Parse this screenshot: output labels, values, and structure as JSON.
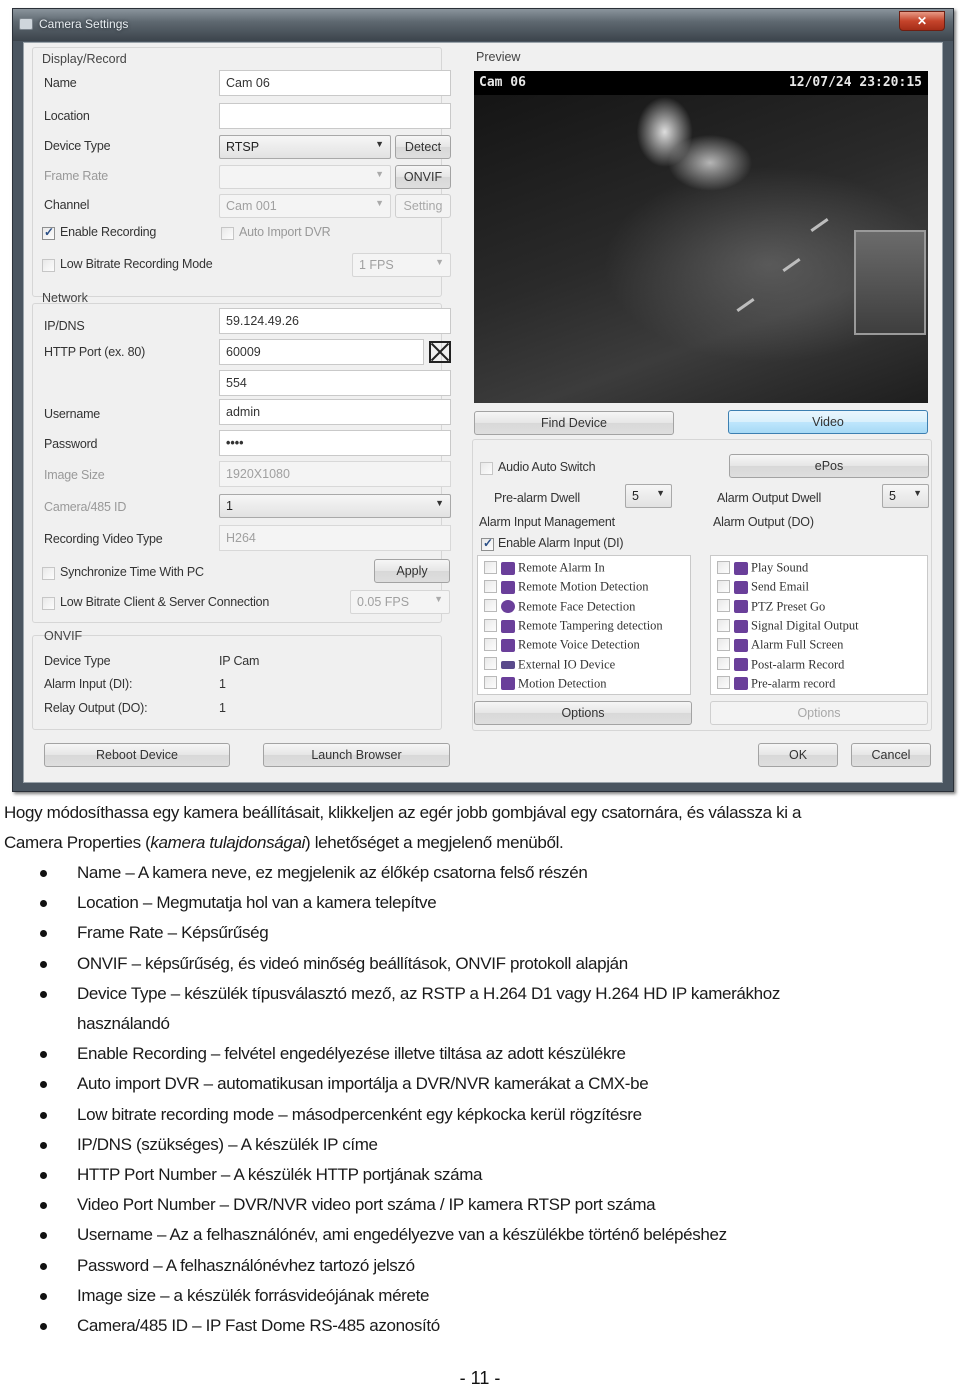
{
  "window": {
    "title": "Camera Settings",
    "close_glyph": "✕"
  },
  "display_record": {
    "section": "Display/Record",
    "name_label": "Name",
    "name_value": "Cam 06",
    "location_label": "Location",
    "location_value": "",
    "device_type_label": "Device Type",
    "device_type_value": "RTSP",
    "detect_button": "Detect",
    "frame_rate_label": "Frame Rate",
    "frame_rate_value": "",
    "onvif_button": "ONVIF",
    "channel_label": "Channel",
    "channel_value": "Cam 001",
    "setting_button": "Setting",
    "enable_recording_label": "Enable Recording",
    "enable_recording_checked": true,
    "auto_import_label": "Auto Import DVR",
    "auto_import_checked": false,
    "low_bitrate_label": "Low Bitrate Recording Mode",
    "low_bitrate_checked": false,
    "low_bitrate_fps": "1 FPS"
  },
  "network": {
    "section": "Network",
    "ip_label": "IP/DNS",
    "ip_value": "59.124.49.26",
    "http_port_label": "HTTP Port (ex. 80)",
    "http_port_value": "60009",
    "video_port_value": "554",
    "username_label": "Username",
    "username_value": "admin",
    "password_label": "Password",
    "password_value": "••••",
    "image_size_label": "Image Size",
    "image_size_value": "1920X1080",
    "camera_id_label": "Camera/485 ID",
    "camera_id_value": "1",
    "video_type_label": "Recording Video Type",
    "video_type_value": "H264",
    "sync_time_label": "Synchronize Time With PC",
    "sync_time_checked": false,
    "apply_button": "Apply",
    "low_bitrate_conn_label": "Low Bitrate Client & Server Connection",
    "low_bitrate_conn_checked": false,
    "low_bitrate_conn_fps": "0.05 FPS"
  },
  "onvif": {
    "section": "ONVIF",
    "device_type_label": "Device Type",
    "device_type_value": "IP Cam",
    "alarm_input_label": "Alarm Input (DI):",
    "alarm_input_value": "1",
    "relay_output_label": "Relay Output (DO):",
    "relay_output_value": "1"
  },
  "preview": {
    "section": "Preview",
    "osd_name": "Cam 06",
    "osd_timestamp": "12/07/24 23:20:15",
    "find_device_button": "Find Device",
    "video_button": "Video"
  },
  "alarm": {
    "audio_auto_switch_label": "Audio Auto Switch",
    "audio_auto_switch_checked": false,
    "epos_button": "ePos",
    "pre_alarm_dwell_label": "Pre-alarm Dwell",
    "pre_alarm_dwell_value": "5",
    "alarm_output_dwell_label": "Alarm Output Dwell",
    "alarm_output_dwell_value": "5",
    "input_mgmt_label": "Alarm Input Management",
    "output_label": "Alarm Output (DO)",
    "enable_alarm_input_label": "Enable Alarm Input (DI)",
    "enable_alarm_input_checked": true,
    "inputs": [
      {
        "label": "Remote Alarm In",
        "icon": "alarm-icon",
        "checked": false
      },
      {
        "label": "Remote Motion Detection",
        "icon": "motion-icon",
        "checked": false
      },
      {
        "label": "Remote Face Detection",
        "icon": "face-icon",
        "checked": false
      },
      {
        "label": "Remote Tampering detection",
        "icon": "tamper-icon",
        "checked": false
      },
      {
        "label": "Remote Voice Detection",
        "icon": "voice-icon",
        "checked": false
      },
      {
        "label": "External IO Device",
        "icon": "io-device-icon",
        "checked": false
      },
      {
        "label": "Motion Detection",
        "icon": "running-man-icon",
        "checked": false
      }
    ],
    "outputs": [
      {
        "label": "Play Sound",
        "icon": "speaker-icon",
        "checked": false
      },
      {
        "label": "Send Email",
        "icon": "email-icon",
        "checked": false
      },
      {
        "label": "PTZ Preset Go",
        "icon": "ptz-icon",
        "checked": false
      },
      {
        "label": "Signal Digital Output",
        "icon": "signal-icon",
        "checked": false
      },
      {
        "label": "Alarm Full Screen",
        "icon": "fullscreen-icon",
        "checked": false
      },
      {
        "label": "Post-alarm Record",
        "icon": "record-icon",
        "checked": false
      },
      {
        "label": "Pre-alarm record",
        "icon": "record-icon",
        "checked": false
      }
    ],
    "input_options_button": "Options",
    "output_options_button": "Options"
  },
  "footer": {
    "reboot_button": "Reboot Device",
    "launch_browser_button": "Launch Browser",
    "ok_button": "OK",
    "cancel_button": "Cancel"
  },
  "document": {
    "intro_1": "Hogy módosíthassa egy kamera beállításait, klikkeljen az egér jobb gombjával egy csatornára, és válassza ki a",
    "intro_2a": "Camera Properties (",
    "intro_2_italic": "kamera tulajdonságai",
    "intro_2b": ") lehetőséget a megjelenő menüből.",
    "bullets": [
      "Name  – A kamera neve, ez megjelenik az élőkép csatorna felső részén",
      "Location – Megmutatja hol van a kamera telepítve",
      "Frame Rate – Képsűrűség",
      "ONVIF – képsűrűség, és videó minőség beállítások, ONVIF protokoll alapján",
      "Device Type – készülék típusválasztó mező, az RSTP a H.264 D1 vagy H.264 HD IP kamerákhoz használandó",
      "Enable Recording – felvétel engedélyezése illetve tiltása az adott készülékre",
      "Auto import DVR – automatikusan importálja a DVR/NVR kamerákat a CMX-be",
      "Low bitrate recording mode – másodpercenként egy képkocka kerül rögzítésre",
      "IP/DNS (szükséges) – A készülék IP címe",
      "HTTP Port Number – A készülék HTTP portjának száma",
      "Video Port Number – DVR/NVR video port száma / IP kamera RTSP port száma",
      "Username – Az a felhasználónév, ami engedélyezve van a készülékbe történő belépéshez",
      "Password – A felhasználónévhez tartozó jelszó",
      "Image size – a készülék forrásvideójának mérete",
      "Camera/485 ID – IP Fast Dome RS-485 azonosító"
    ],
    "page_number": "- 11 -"
  }
}
